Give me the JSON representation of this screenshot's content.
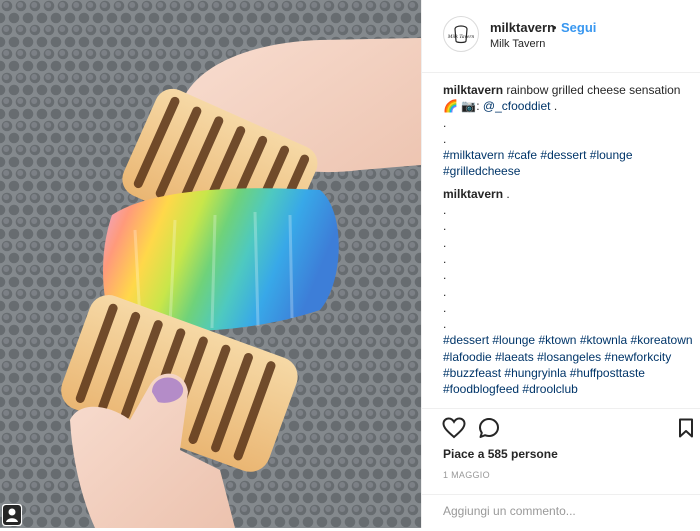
{
  "post": {
    "username": "milktavern",
    "separator": "•",
    "follow_label": "Segui",
    "location": "Milk Tavern",
    "avatar_text": "Milk Tavern"
  },
  "caption": {
    "author": "milktavern",
    "text_1": "rainbow grilled cheese sensation 🌈 📷:",
    "mention": "@_cfooddiet",
    "text_end": ".",
    "dots": [
      ".",
      "."
    ],
    "tags": [
      "#milktavern",
      "#cafe",
      "#dessert",
      "#lounge",
      "#grilledcheese"
    ]
  },
  "comment": {
    "author": "milktavern",
    "text": ".",
    "dots": [
      ".",
      ".",
      ".",
      ".",
      ".",
      ".",
      ".",
      "."
    ],
    "tags": [
      "#dessert",
      "#lounge",
      "#ktown",
      "#ktownla",
      "#koreatown",
      "#lafoodie",
      "#laeats",
      "#losangeles",
      "#newforkcity",
      "#buzzfeast",
      "#hungryinla",
      "#huffposttaste",
      "#foodblogfeed",
      "#droolclub"
    ]
  },
  "likes": "Piace a 585 persone",
  "date": "1 MAGGIO",
  "add_comment_placeholder": "Aggiungi un commento...",
  "icons": {
    "like": "heart-icon",
    "comment": "comment-icon",
    "save": "bookmark-icon",
    "user": "user-icon"
  },
  "colors": {
    "link": "#3897f0",
    "hashtag": "#003569",
    "muted": "#999999",
    "border": "#efefef"
  }
}
